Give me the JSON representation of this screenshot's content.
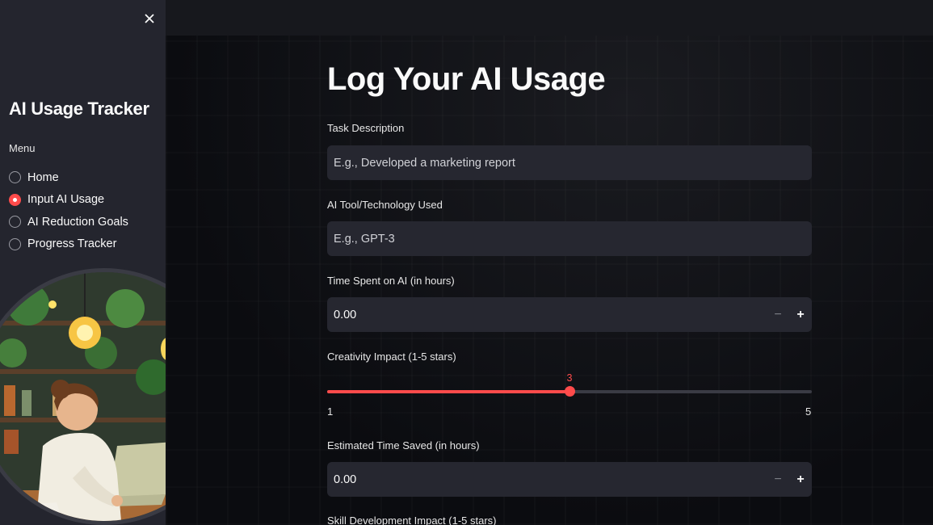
{
  "sidebar": {
    "title": "AI Usage Tracker",
    "menu_label": "Menu",
    "items": [
      {
        "label": "Home",
        "selected": false
      },
      {
        "label": "Input AI Usage",
        "selected": true
      },
      {
        "label": "AI Reduction Goals",
        "selected": false
      },
      {
        "label": "Progress Tracker",
        "selected": false
      }
    ],
    "illustration_icon": "woman-working-on-laptop-illustration"
  },
  "main": {
    "title": "Log Your AI Usage",
    "task": {
      "label": "Task Description",
      "placeholder": "E.g., Developed a marketing report"
    },
    "tool": {
      "label": "AI Tool/Technology Used",
      "placeholder": "E.g., GPT-3"
    },
    "time_spent": {
      "label": "Time Spent on AI (in hours)",
      "value": "0.00",
      "minus": "−",
      "plus": "+"
    },
    "creativity": {
      "label": "Creativity Impact (1-5 stars)",
      "value": 3,
      "value_text": "3",
      "min": 1,
      "min_text": "1",
      "max": 5,
      "max_text": "5"
    },
    "time_saved": {
      "label": "Estimated Time Saved (in hours)",
      "value": "0.00",
      "minus": "−",
      "plus": "+"
    },
    "skill": {
      "label": "Skill Development Impact (1-5 stars)"
    }
  },
  "colors": {
    "accent": "#ff4b4b",
    "sidebar_bg": "#24252e",
    "input_bg": "#262730"
  }
}
